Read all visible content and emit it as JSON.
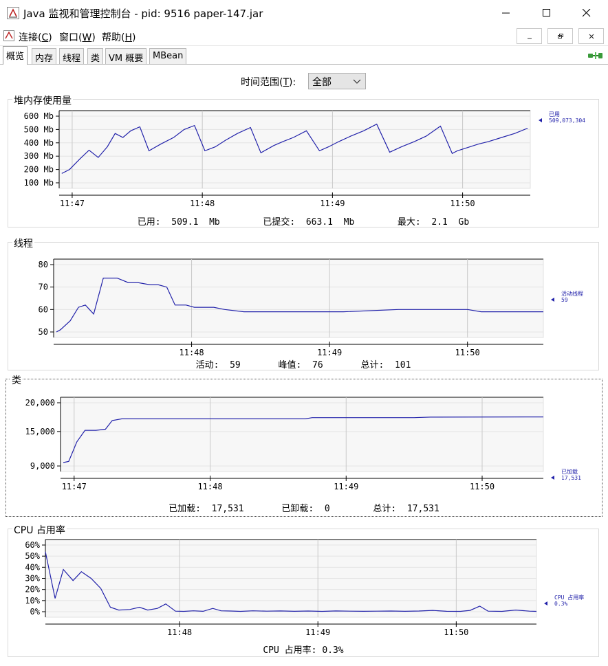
{
  "window": {
    "title": "Java 监视和管理控制台 - pid: 9516 paper-147.jar"
  },
  "menu": {
    "items": [
      {
        "label": "连接(",
        "mnemonic": "C",
        "suffix": ")"
      },
      {
        "label": "窗口(",
        "mnemonic": "W",
        "suffix": ")"
      },
      {
        "label": "帮助(",
        "mnemonic": "H",
        "suffix": ")"
      }
    ]
  },
  "tabs": [
    "概览",
    "内存",
    "线程",
    "类",
    "VM 概要",
    "MBean"
  ],
  "active_tab": "概览",
  "time_range": {
    "label": "时间范围(",
    "mnemonic": "T",
    "suffix": "):",
    "value": "全部"
  },
  "heap": {
    "title": "堆内存使用量",
    "legend_name": "已用",
    "legend_value": "509,073,304",
    "stats": [
      {
        "label": "已用:",
        "value": "509.1  Mb"
      },
      {
        "label": "已提交:",
        "value": "663.1  Mb"
      },
      {
        "label": "最大:",
        "value": "2.1  Gb"
      }
    ]
  },
  "threads": {
    "title": "线程",
    "legend_name": "活动线程",
    "legend_value": "59",
    "stats": [
      {
        "label": "活动:",
        "value": "59"
      },
      {
        "label": "峰值:",
        "value": "76"
      },
      {
        "label": "总计:",
        "value": "101"
      }
    ]
  },
  "classes": {
    "title": "类",
    "legend_name": "已加载",
    "legend_value": "17,531",
    "stats": [
      {
        "label": "已加载:",
        "value": "17,531"
      },
      {
        "label": "已卸载:",
        "value": "0"
      },
      {
        "label": "总计:",
        "value": "17,531"
      }
    ]
  },
  "cpu": {
    "title": "CPU 占用率",
    "legend_name": "CPU 占用率",
    "legend_value": "0.3%",
    "stats": [
      {
        "label": "CPU 占用率:",
        "value": "0.3%"
      }
    ]
  },
  "colors": {
    "line": "#2222aa",
    "grid": "#c8c8c8",
    "plot_bg": "#f7f7f7",
    "frame": "#808080"
  },
  "chart_data": [
    {
      "type": "line",
      "name": "heap",
      "ylabel_ticks": [
        "100 Mb",
        "200 Mb",
        "300 Mb",
        "400 Mb",
        "500 Mb",
        "600 Mb"
      ],
      "ylim": [
        100,
        600
      ],
      "xlim": [
        0,
        3.62
      ],
      "x_ticks": [
        {
          "x": 0.1,
          "label": "11:47"
        },
        {
          "x": 1.1,
          "label": "11:48"
        },
        {
          "x": 2.1,
          "label": "11:49"
        },
        {
          "x": 3.1,
          "label": "11:50"
        }
      ],
      "series": [
        {
          "name": "已用",
          "x": [
            0.02,
            0.08,
            0.16,
            0.23,
            0.3,
            0.37,
            0.43,
            0.49,
            0.55,
            0.62,
            0.69,
            0.78,
            0.88,
            0.96,
            1.04,
            1.12,
            1.2,
            1.28,
            1.37,
            1.47,
            1.55,
            1.65,
            1.72,
            1.8,
            1.9,
            2.0,
            2.07,
            2.15,
            2.24,
            2.34,
            2.44,
            2.54,
            2.63,
            2.73,
            2.82,
            2.93,
            3.02,
            3.06,
            3.14,
            3.22,
            3.3,
            3.4,
            3.5,
            3.6
          ],
          "values": [
            170,
            200,
            280,
            345,
            290,
            370,
            470,
            440,
            490,
            520,
            340,
            390,
            440,
            500,
            530,
            340,
            370,
            420,
            470,
            515,
            325,
            380,
            410,
            440,
            490,
            340,
            370,
            410,
            450,
            490,
            540,
            330,
            370,
            410,
            450,
            525,
            320,
            340,
            365,
            390,
            410,
            440,
            470,
            510
          ]
        }
      ]
    },
    {
      "type": "line",
      "name": "threads",
      "ylim": [
        50,
        80
      ],
      "y_ticks": [
        50,
        60,
        70,
        80
      ],
      "xlim": [
        0,
        3.55
      ],
      "x_ticks": [
        {
          "x": 1.0,
          "label": "11:48"
        },
        {
          "x": 2.0,
          "label": "11:49"
        },
        {
          "x": 3.0,
          "label": "11:50"
        }
      ],
      "series": [
        {
          "name": "活动线程",
          "x": [
            0.02,
            0.05,
            0.12,
            0.18,
            0.23,
            0.29,
            0.36,
            0.46,
            0.54,
            0.61,
            0.7,
            0.76,
            0.82,
            0.88,
            0.96,
            1.02,
            1.16,
            1.24,
            1.38,
            2.1,
            2.5,
            3.0,
            3.1,
            3.55
          ],
          "values": [
            50,
            51,
            55,
            61,
            62,
            58,
            74,
            74,
            72,
            72,
            71,
            71,
            70,
            62,
            62,
            61,
            61,
            60,
            59,
            59,
            60,
            60,
            59,
            59
          ]
        }
      ]
    },
    {
      "type": "line",
      "name": "classes",
      "ylim": [
        9000,
        20000
      ],
      "y_ticks": [
        9000,
        15000,
        20000
      ],
      "xlim": [
        0,
        3.55
      ],
      "x_ticks": [
        {
          "x": 0.1,
          "label": "11:47"
        },
        {
          "x": 1.1,
          "label": "11:48"
        },
        {
          "x": 2.1,
          "label": "11:49"
        },
        {
          "x": 3.1,
          "label": "11:50"
        }
      ],
      "series": [
        {
          "name": "已加载",
          "x": [
            0.02,
            0.06,
            0.12,
            0.18,
            0.26,
            0.33,
            0.38,
            0.45,
            0.6,
            1.2,
            1.8,
            1.85,
            2.6,
            2.72,
            3.55
          ],
          "values": [
            9600,
            9800,
            13200,
            15200,
            15200,
            15400,
            16900,
            17200,
            17200,
            17200,
            17200,
            17400,
            17400,
            17500,
            17531
          ]
        }
      ]
    },
    {
      "type": "line",
      "name": "cpu",
      "ylim": [
        0,
        60
      ],
      "y_ticks": [
        "0%",
        "10%",
        "20%",
        "30%",
        "40%",
        "50%",
        "60%"
      ],
      "xlim": [
        0,
        3.55
      ],
      "x_ticks": [
        {
          "x": 0.97,
          "label": "11:48"
        },
        {
          "x": 1.97,
          "label": "11:49"
        },
        {
          "x": 2.97,
          "label": "11:50"
        }
      ],
      "series": [
        {
          "name": "CPU 占用率",
          "x": [
            0.0,
            0.07,
            0.13,
            0.2,
            0.26,
            0.33,
            0.4,
            0.47,
            0.53,
            0.61,
            0.68,
            0.74,
            0.81,
            0.87,
            0.94,
            1.0,
            1.07,
            1.14,
            1.21,
            1.27,
            1.34,
            1.41,
            1.5,
            1.6,
            1.7,
            1.8,
            1.9,
            2.0,
            2.1,
            2.2,
            2.3,
            2.4,
            2.5,
            2.6,
            2.7,
            2.8,
            2.9,
            3.0,
            3.07,
            3.14,
            3.2,
            3.3,
            3.4,
            3.5,
            3.55
          ],
          "values": [
            54,
            12,
            38,
            28,
            36,
            30,
            21,
            4,
            1.5,
            2,
            4,
            1.5,
            3,
            7,
            0.5,
            0.3,
            0.8,
            0.4,
            3,
            0.8,
            0.6,
            0.3,
            0.8,
            0.5,
            0.7,
            0.4,
            0.6,
            0.3,
            0.7,
            0.5,
            0.4,
            0.5,
            0.6,
            0.4,
            0.6,
            1.2,
            0.4,
            0.3,
            1.2,
            5,
            0.5,
            0.3,
            1.5,
            0.5,
            0.3
          ]
        }
      ]
    }
  ]
}
